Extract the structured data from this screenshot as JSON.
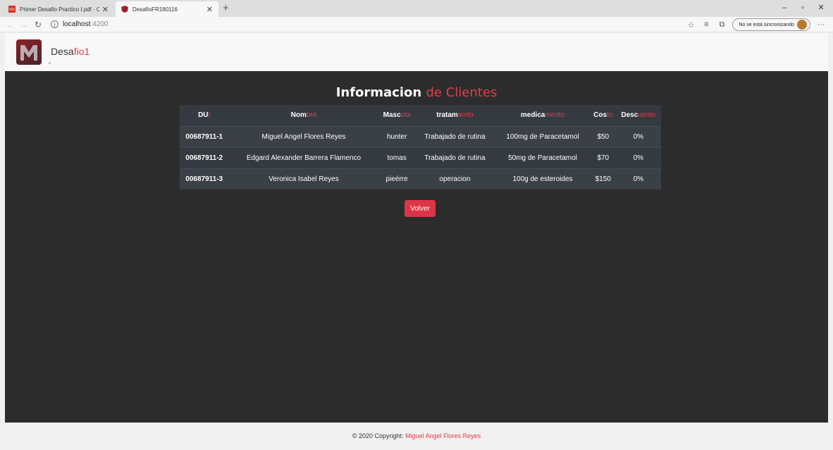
{
  "browser": {
    "tabs": [
      {
        "title": "Primer Desafio Practico I.pdf - O"
      },
      {
        "title": "DesafioFR180116"
      }
    ],
    "url_host": "localhost",
    "url_port": ":4200",
    "sync_label": "No se está sincronizando"
  },
  "navbar": {
    "brand_main": "Desa",
    "brand_accent": "fio1"
  },
  "page": {
    "title_main": "Informacion",
    "title_accent": "de Clientes",
    "table": {
      "headers": [
        {
          "main": "DU",
          "accent": "I"
        },
        {
          "main": "Nom",
          "accent": "bre"
        },
        {
          "main": "Masc",
          "accent": "ota"
        },
        {
          "main": "tratam",
          "accent": "iento"
        },
        {
          "main": "medica",
          "accent": "mento"
        },
        {
          "main": "Cos",
          "accent": "to"
        },
        {
          "main": "Desc",
          "accent": "uento"
        }
      ],
      "rows": [
        [
          "00687911-1",
          "Miguel Angel Flores Reyes",
          "hunter",
          "Trabajado de rutina",
          "100mg de Paracetamol",
          "$50",
          "0%"
        ],
        [
          "00687911-2",
          "Edgard Alexander Barrera Flamenco",
          "tomas",
          "Trabajado de rutina",
          "50mg de Paracetamol",
          "$70",
          "0%"
        ],
        [
          "00687911-3",
          "Veronica Isabel Reyes",
          "pieérre",
          "operacion",
          "100g de esteroides",
          "$150",
          "0%"
        ]
      ]
    },
    "volver_label": "Volver"
  },
  "footer": {
    "copyright": "© 2020 Copyright:",
    "author": "Miguel Angel Flores Reyes"
  },
  "colors": {
    "accent": "#e23d4b",
    "main_bg": "#2c2c2c",
    "table_head": "#343a40",
    "button": "#dc3545"
  }
}
